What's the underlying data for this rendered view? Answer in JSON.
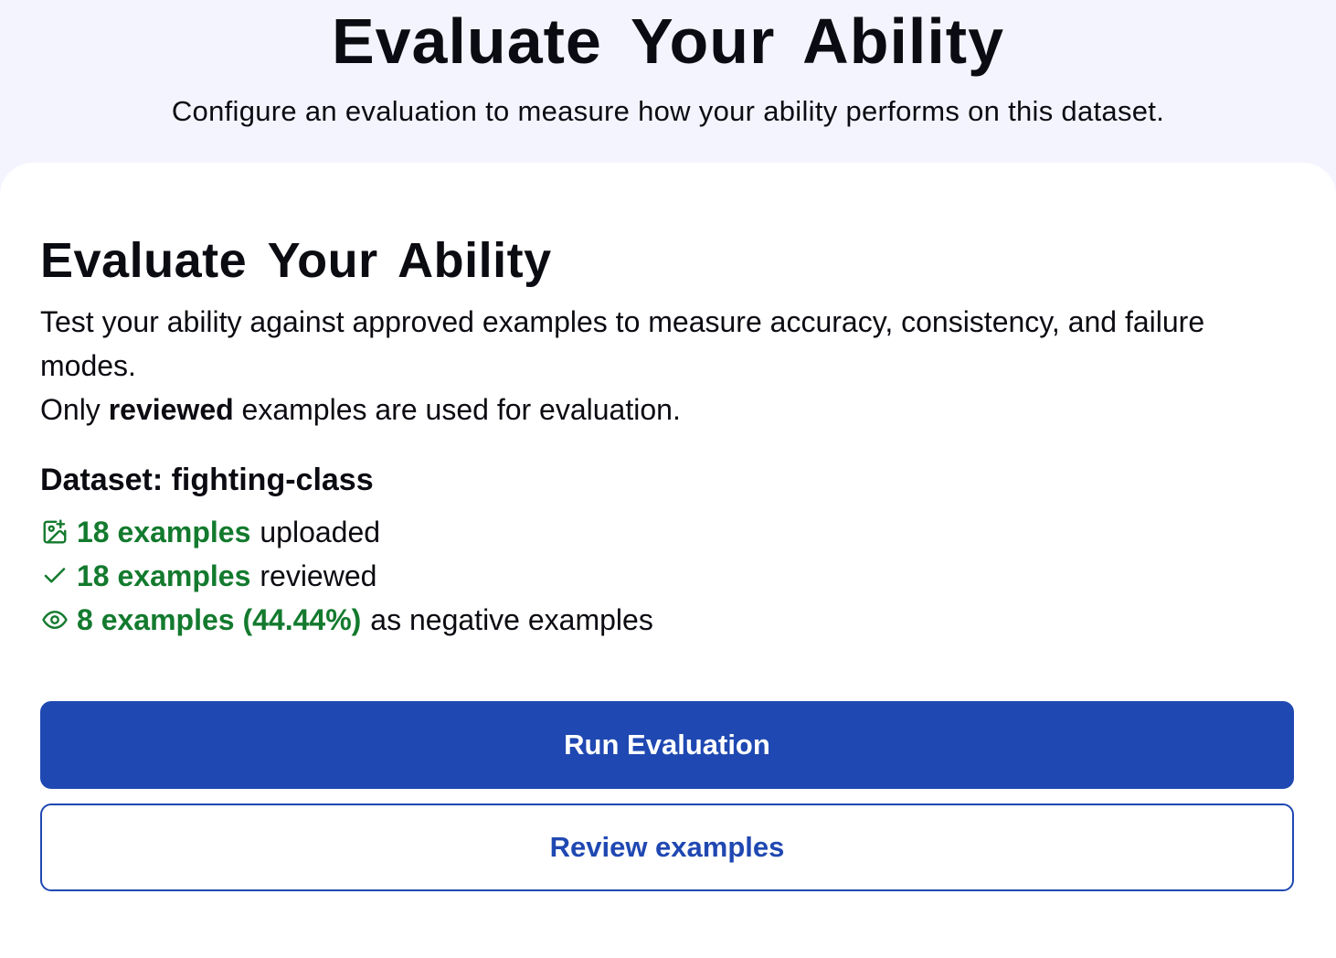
{
  "header": {
    "title": "Evaluate Your Ability",
    "subtitle": "Configure an evaluation to measure how your ability performs on this dataset."
  },
  "card": {
    "title": "Evaluate Your Ability",
    "description_line1": "Test your ability against approved examples to measure accuracy, consistency, and failure modes.",
    "description_line2_prefix": "Only ",
    "description_line2_bold": "reviewed",
    "description_line2_suffix": " examples are used for evaluation.",
    "dataset_heading": "Dataset: fighting-class",
    "stats": {
      "uploaded": {
        "icon": "image-plus-icon",
        "highlight": "18 examples",
        "text": "uploaded"
      },
      "reviewed": {
        "icon": "check-icon",
        "highlight": "18 examples",
        "text": "reviewed"
      },
      "negative": {
        "icon": "eye-icon",
        "highlight": "8 examples (44.44%)",
        "text": "as negative examples"
      }
    },
    "buttons": {
      "run_label": "Run Evaluation",
      "review_label": "Review examples"
    }
  },
  "colors": {
    "background": "#f4f4fe",
    "card": "#ffffff",
    "accent_green": "#137a2e",
    "primary_blue": "#1f48b2",
    "text": "#0b0b12"
  }
}
